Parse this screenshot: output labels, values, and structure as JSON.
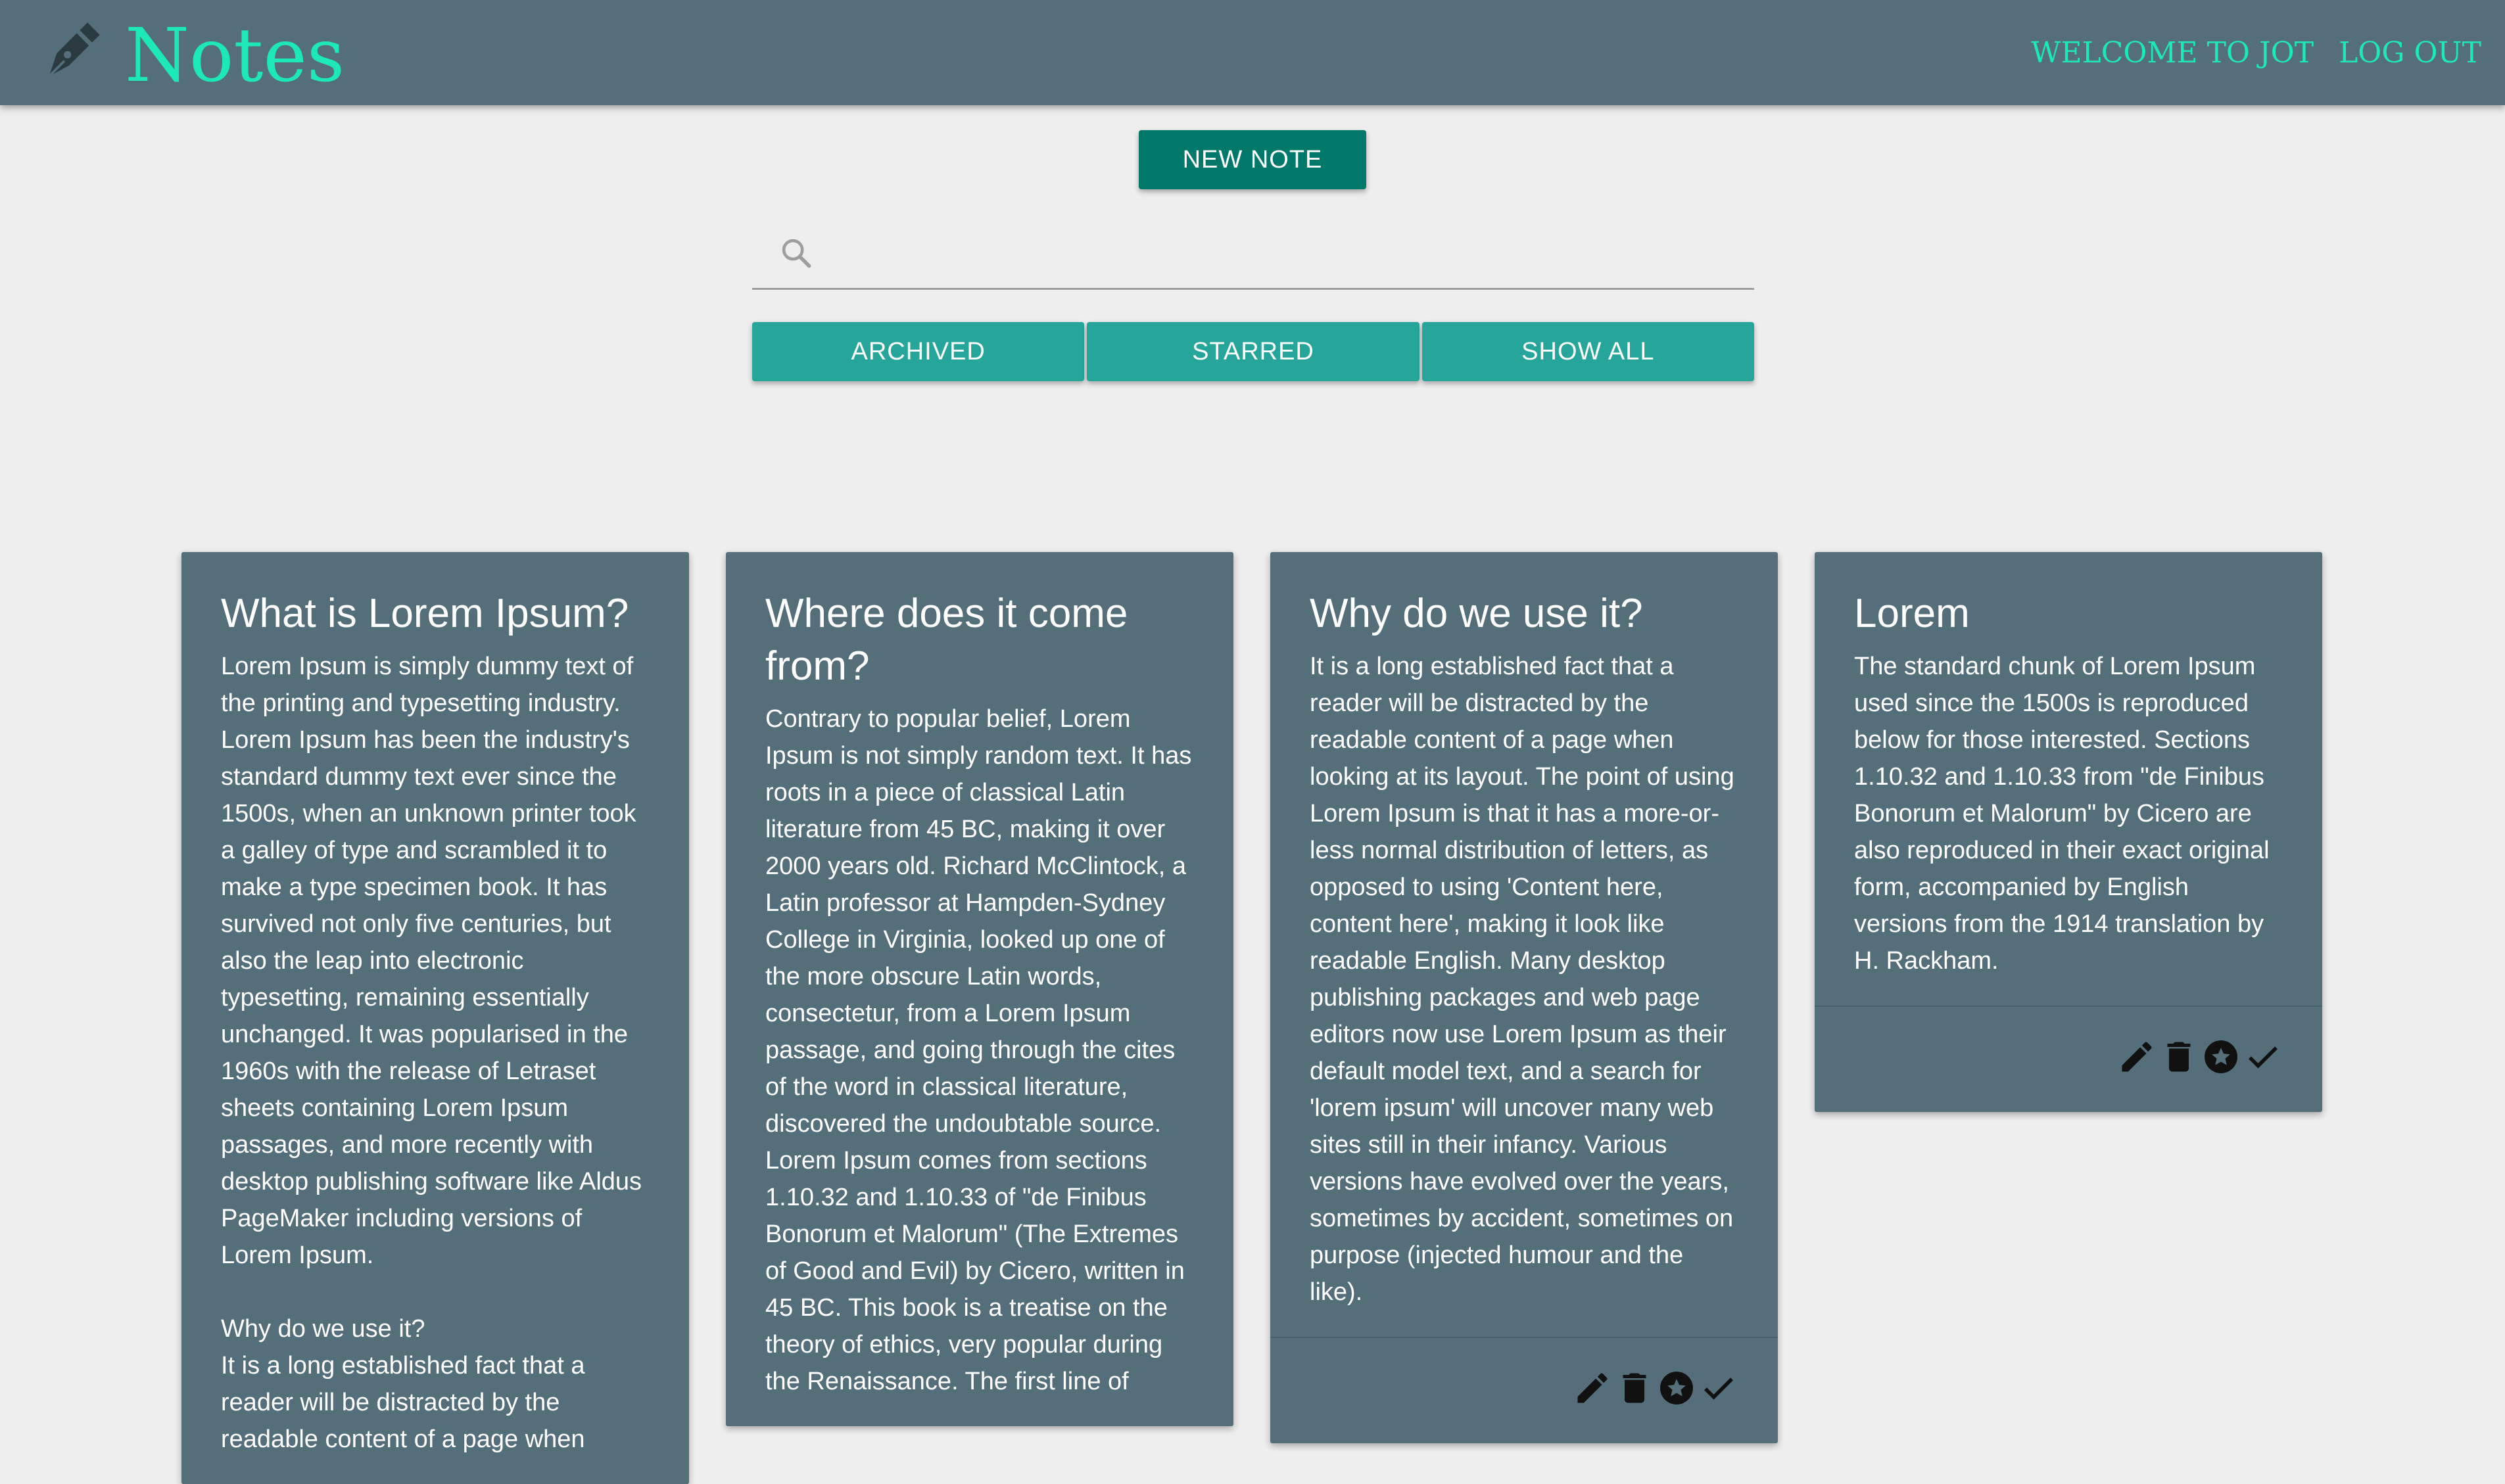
{
  "header": {
    "brand_title": "Notes",
    "brand_icon": "fountain-pen-icon",
    "links": [
      {
        "label": "WELCOME TO JOT"
      },
      {
        "label": "LOG OUT"
      }
    ]
  },
  "toolbar": {
    "new_note_label": "NEW NOTE",
    "search_icon": "search-icon",
    "search_value": "",
    "filters": [
      "ARCHIVED",
      "STARRED",
      "SHOW ALL"
    ]
  },
  "colors": {
    "header_bg": "#546e7a",
    "brand_accent": "#1de9b6",
    "new_note_bg": "#00796b",
    "filter_bg": "#26a69a",
    "card_bg": "#546e7a",
    "page_bg": "#eeeeee"
  },
  "notes": [
    {
      "title": "What is Lorem Ipsum?",
      "body": "Lorem Ipsum is simply dummy text of the printing and typesetting industry. Lorem Ipsum has been the industry's standard dummy text ever since the 1500s, when an unknown printer took a galley of type and scrambled it to make a type specimen book. It has survived not only five centuries, but also the leap into electronic typesetting, remaining essentially unchanged. It was popularised in the 1960s with the release of Letraset sheets containing Lorem Ipsum passages, and more recently with desktop publishing software like Aldus PageMaker including versions of Lorem Ipsum.\n\nWhy do we use it?\nIt is a long established fact that a reader will be distracted by the readable content of a page when"
    },
    {
      "title": "Where does it come from?",
      "body": "Contrary to popular belief, Lorem Ipsum is not simply random text. It has roots in a piece of classical Latin literature from 45 BC, making it over 2000 years old. Richard McClintock, a Latin professor at Hampden-Sydney College in Virginia, looked up one of the more obscure Latin words, consectetur, from a Lorem Ipsum passage, and going through the cites of the word in classical literature, discovered the undoubtable source. Lorem Ipsum comes from sections 1.10.32 and 1.10.33 of \"de Finibus Bonorum et Malorum\" (The Extremes of Good and Evil) by Cicero, written in 45 BC. This book is a treatise on the theory of ethics, very popular during the Renaissance. The first line of"
    },
    {
      "title": "Why do we use it?",
      "body": "It is a long established fact that a reader will be distracted by the readable content of a page when looking at its layout. The point of using Lorem Ipsum is that it has a more-or-less normal distribution of letters, as opposed to using 'Content here, content here', making it look like readable English. Many desktop publishing packages and web page editors now use Lorem Ipsum as their default model text, and a search for 'lorem ipsum' will uncover many web sites still in their infancy. Various versions have evolved over the years, sometimes by accident, sometimes on purpose (injected humour and the like)."
    },
    {
      "title": "Lorem",
      "body": "The standard chunk of Lorem Ipsum used since the 1500s is reproduced below for those interested. Sections 1.10.32 and 1.10.33 from \"de Finibus Bonorum et Malorum\" by Cicero are also reproduced in their exact original form, accompanied by English versions from the 1914 translation by H. Rackham."
    }
  ],
  "note_actions": [
    "edit-icon",
    "delete-icon",
    "star-icon",
    "check-icon"
  ]
}
